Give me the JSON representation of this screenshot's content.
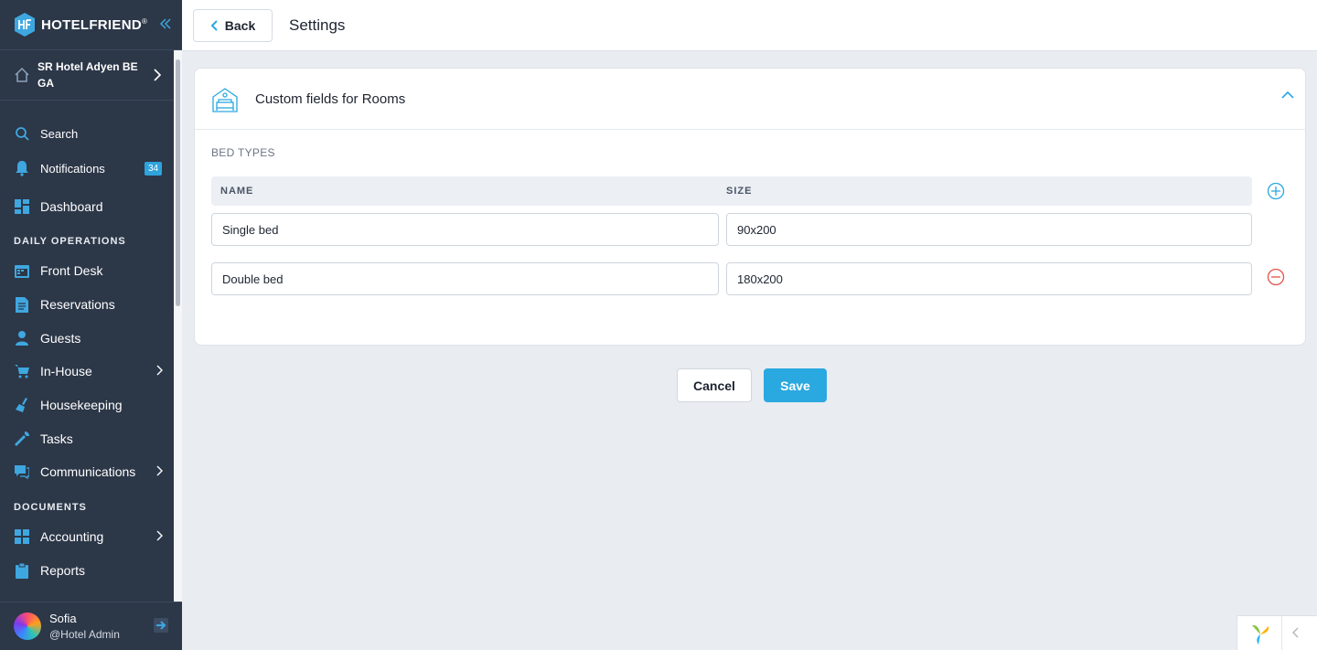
{
  "brand": {
    "name": "HOTELFRIEND",
    "trademark": "®"
  },
  "hotel": {
    "name": "SR Hotel Adyen BE GA"
  },
  "nav": {
    "search": "Search",
    "notifications": "Notifications",
    "notifications_count": "34",
    "dashboard": "Dashboard",
    "daily_operations": "DAILY OPERATIONS",
    "front_desk": "Front Desk",
    "reservations": "Reservations",
    "guests": "Guests",
    "in_house": "In-House",
    "housekeeping": "Housekeeping",
    "tasks": "Tasks",
    "communications": "Communications",
    "documents": "DOCUMENTS",
    "accounting": "Accounting",
    "reports": "Reports"
  },
  "user": {
    "name": "Sofia",
    "role": "@Hotel Admin"
  },
  "header": {
    "back_label": "Back",
    "title": "Settings"
  },
  "card": {
    "title": "Custom fields for Rooms",
    "section_label": "BED TYPES",
    "columns": {
      "name": "NAME",
      "size": "SIZE"
    },
    "rows": [
      {
        "name": "Single bed",
        "size": "90x200"
      },
      {
        "name": "Double bed",
        "size": "180x200"
      }
    ]
  },
  "actions": {
    "cancel": "Cancel",
    "save": "Save"
  },
  "colors": {
    "sidebar": "#2c3748",
    "accent": "#2aa8e0",
    "danger": "#e5534b"
  }
}
